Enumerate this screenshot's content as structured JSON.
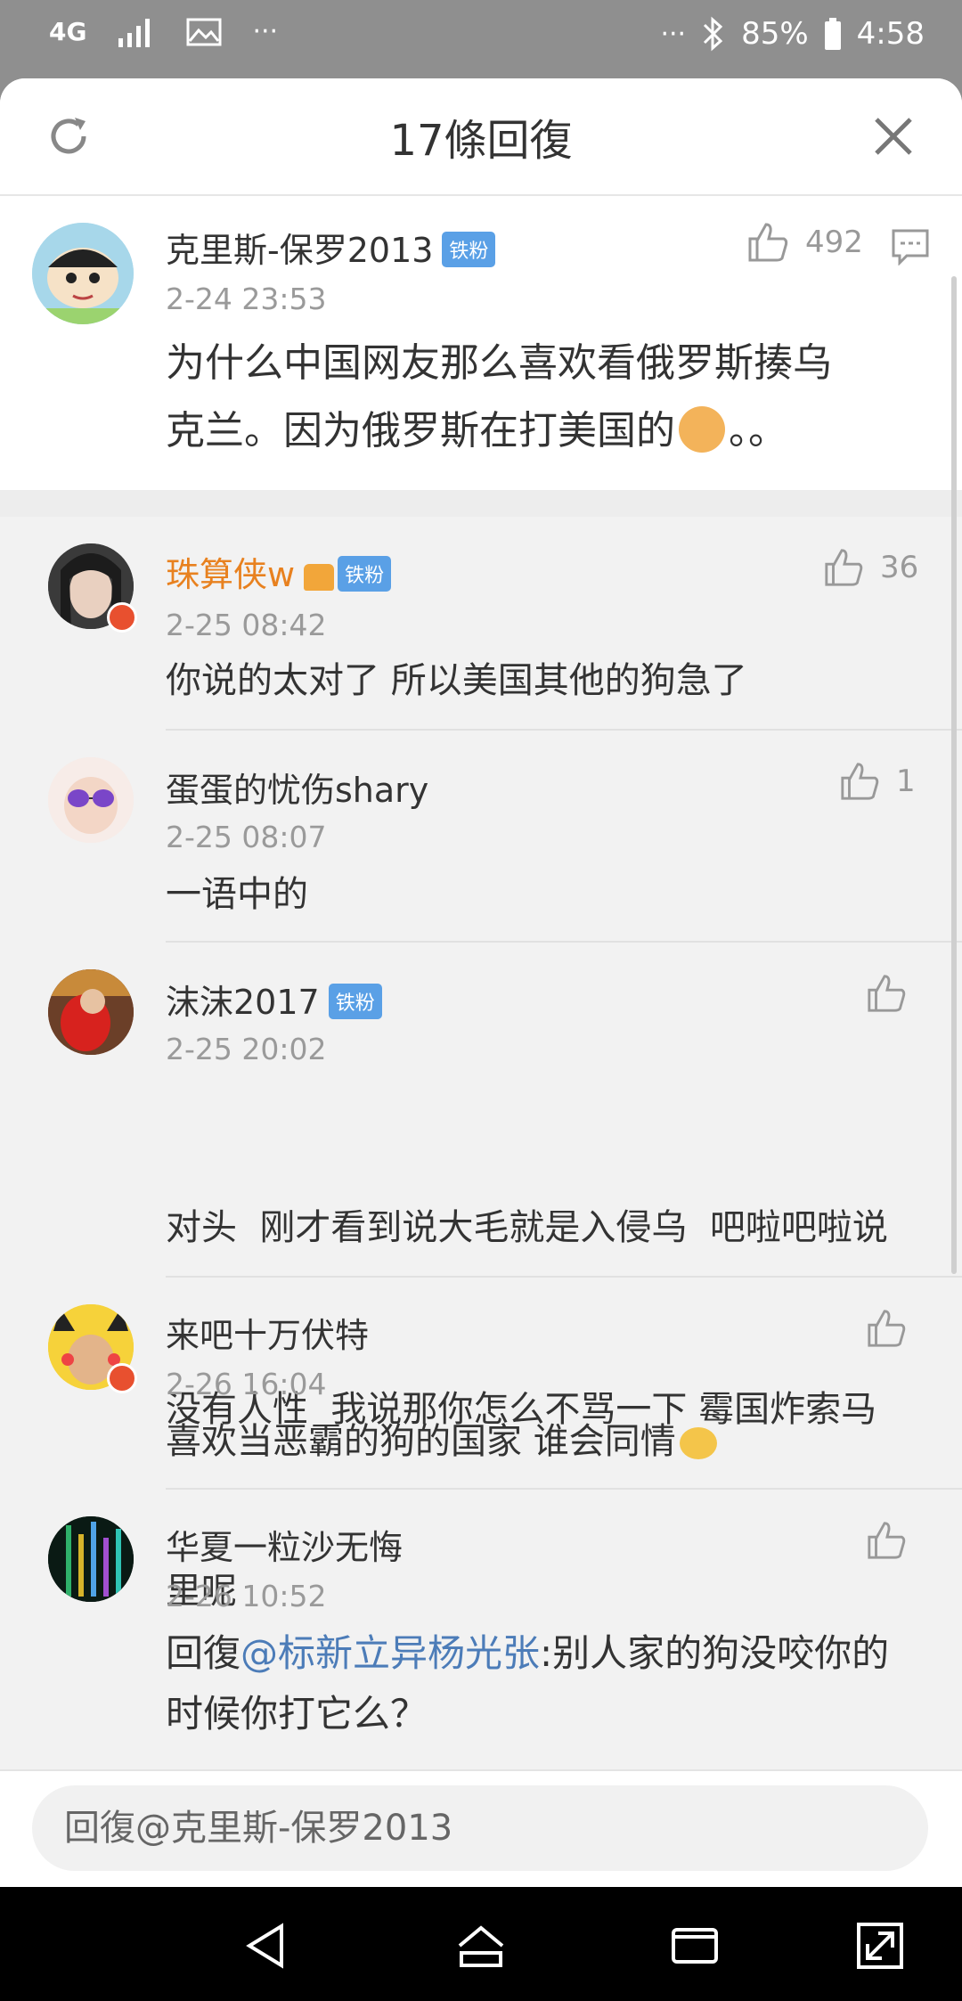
{
  "status": {
    "network": "4G",
    "battery": "85%",
    "time": "4:58",
    "more_left": "···",
    "more_right": "···"
  },
  "header": {
    "title": "17條回復"
  },
  "main_comment": {
    "author": "克里斯-保罗2013",
    "badge": "铁粉",
    "date": "2-24 23:53",
    "likes": "492",
    "text_line1": "为什么中国网友那么喜欢看俄罗斯揍乌",
    "text_line2": "克兰。因为俄罗斯在打美国的",
    "text_tail": "。。"
  },
  "replies": [
    {
      "author": "珠算侠w",
      "badge": "铁粉",
      "date": "2-25 08:42",
      "likes": "36",
      "text": "你说的太对了 所以美国其他的狗急了"
    },
    {
      "author": "蛋蛋的忧伤shary",
      "date": "2-25 08:07",
      "likes": "1",
      "text": "一语中的"
    },
    {
      "author": "沫沫2017",
      "badge": "铁粉",
      "date": "2-25 20:02",
      "likes": "",
      "line1": "对头  刚才看到说大毛就是入侵乌  吧啦吧啦说",
      "line2": "没有人性  我说那你怎么不骂一下 霉国炸索马",
      "line3": "里呢"
    },
    {
      "author": "来吧十万伏特",
      "date": "2-26 16:04",
      "likes": "",
      "text": "喜欢当恶霸的狗的国家 谁会同情"
    },
    {
      "author": "华夏一粒沙无悔",
      "date": "2-26 10:52",
      "likes": "",
      "prefix": "回復",
      "mention": "@标新立异杨光张",
      "rest": ":别人家的狗没咬你的",
      "line2": "时候你打它么？"
    }
  ],
  "input": {
    "placeholder": "回復@克里斯-保罗2013"
  },
  "colors": {
    "accent_orange": "#e8811f",
    "mention_blue": "#4c7cb8",
    "badge_blue": "#5aa0e6"
  }
}
